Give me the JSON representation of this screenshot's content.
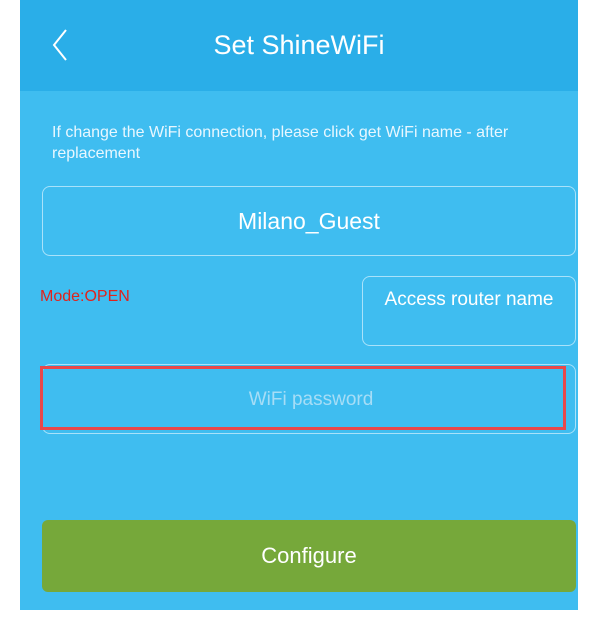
{
  "header": {
    "title": "Set ShineWiFi",
    "back_icon": "chevron-left-icon"
  },
  "hint": {
    "text": "If change the WiFi connection, please click get WiFi name - after replacement"
  },
  "wifi": {
    "name": "Milano_Guest",
    "mode": "Mode:OPEN",
    "access_router_label": "Access router name",
    "password_placeholder": "WiFi password",
    "password_value": ""
  },
  "actions": {
    "configure_label": "Configure"
  },
  "colors": {
    "header_bg": "#2aaee8",
    "screen_bg": "#3fbdf0",
    "mode_text": "#e0231c",
    "configure_bg": "#76a83a",
    "highlight": "#e8484a"
  }
}
